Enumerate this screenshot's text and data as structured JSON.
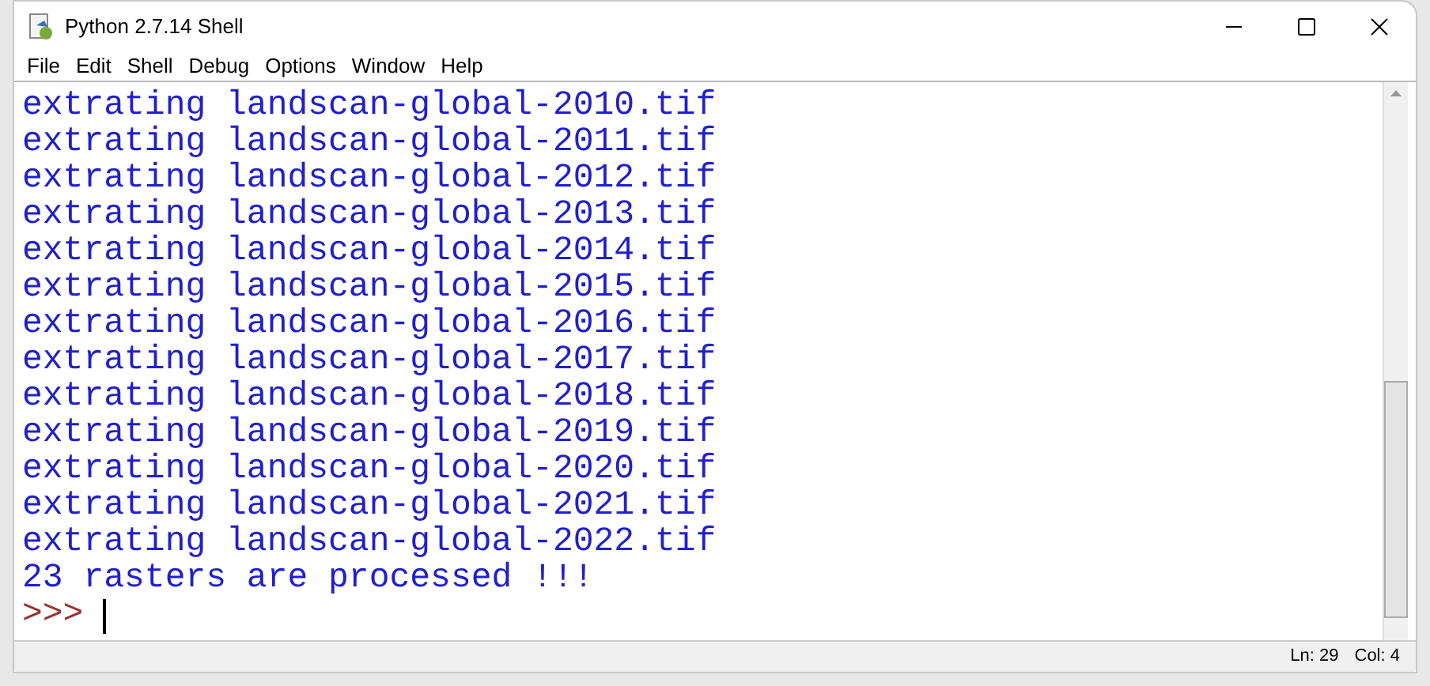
{
  "window": {
    "title": "Python 2.7.14 Shell"
  },
  "menu": [
    "File",
    "Edit",
    "Shell",
    "Debug",
    "Options",
    "Window",
    "Help"
  ],
  "output_lines": [
    "extrating landscan-global-2010.tif",
    "extrating landscan-global-2011.tif",
    "extrating landscan-global-2012.tif",
    "extrating landscan-global-2013.tif",
    "extrating landscan-global-2014.tif",
    "extrating landscan-global-2015.tif",
    "extrating landscan-global-2016.tif",
    "extrating landscan-global-2017.tif",
    "extrating landscan-global-2018.tif",
    "extrating landscan-global-2019.tif",
    "extrating landscan-global-2020.tif",
    "extrating landscan-global-2021.tif",
    "extrating landscan-global-2022.tif",
    "23 rasters are processed !!!"
  ],
  "prompt": ">>>",
  "status_bar": {
    "line": "Ln: 29",
    "column": "Col: 4"
  }
}
